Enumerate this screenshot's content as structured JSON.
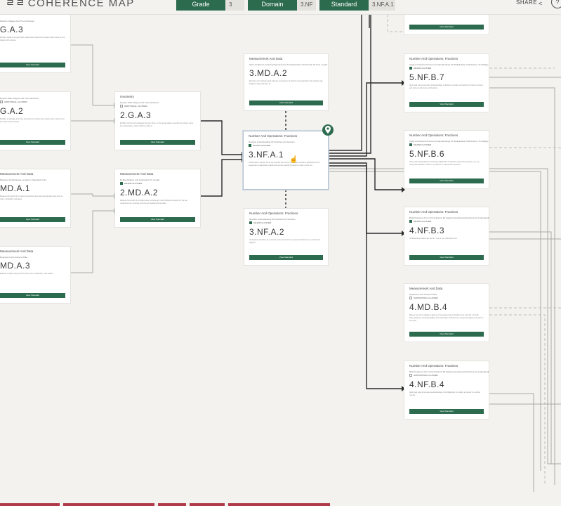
{
  "app": {
    "logo_mark": "ㄹㄹ",
    "title": "COHERENCE MAP"
  },
  "filters": [
    {
      "label": "Grade",
      "value": "3"
    },
    {
      "label": "Domain",
      "value": "3.NF"
    },
    {
      "label": "Standard",
      "value": "3.NF.A.1"
    }
  ],
  "share": {
    "label": "SHARE",
    "icon": "share-icon"
  },
  "help_icon": "?",
  "cards": [
    {
      "id": "l1",
      "domain": "",
      "cluster": "Partition Shapes And Their Attributes",
      "flag": "",
      "flag_type": "major",
      "code": "G.A.3",
      "desc": "Partition shapes into parts with equal areas. Express the area of each part as a unit fraction of the whole.",
      "button": "View Standard"
    },
    {
      "id": "l2",
      "domain": "",
      "cluster": "Reason With Shapes And Their Attributes",
      "flag": "ADDITIONAL CLUSTER",
      "flag_type": "support",
      "code": "G.A.2",
      "desc": "Partition a rectangle into rows and columns of same-size squares and count to find the total number of them.",
      "button": "View Standard"
    },
    {
      "id": "l3",
      "domain": "Measurement And Data",
      "cluster": "Measure And Estimate Lengths In Standard Units",
      "flag": "",
      "flag_type": "major",
      "code": "MD.A.1",
      "desc": "Measure the length of an object by selecting and using appropriate tools such as rulers, yardsticks, and tapes.",
      "button": "View Standard"
    },
    {
      "id": "l4",
      "domain": "Measurement And Data",
      "cluster": "Represent And Interpret Data",
      "flag": "",
      "flag_type": "major",
      "code": "MD.A.3",
      "desc": "Estimate lengths using units of inches, feet, centimeters, and meters.",
      "button": "View Standard"
    },
    {
      "id": "m1",
      "domain": "Geometry",
      "cluster": "Reason With Shapes And Their Attributes",
      "flag": "ADDITIONAL CLUSTER",
      "flag_type": "support",
      "code": "2.G.A.3",
      "desc": "Partition circles and rectangles into two, three, or four equal shares, describe the shares using the words halves, thirds, half of, a third of.",
      "button": "View Standard"
    },
    {
      "id": "m2",
      "domain": "Measurement And Data",
      "cluster": "Relate Addition And Subtraction To Length",
      "flag": "MAJOR CLUSTER",
      "flag_type": "major",
      "code": "2.MD.A.2",
      "desc": "Measure the length of an object twice, using length units of different lengths for the two measurements; describe how the two measurements relate.",
      "button": "View Standard"
    },
    {
      "id": "c1",
      "domain": "Measurement And Data",
      "cluster": "Solve Problems Involving Measurement And Estimation Of Intervals Of Time, Liquid Volumes, And Masses Of Objects",
      "flag": "",
      "flag_type": "major",
      "code": "3.MD.A.2",
      "desc": "Measure and estimate liquid volumes and masses of objects using standard units of grams (g), kilograms (kg), and liters (l).",
      "button": "View Standard"
    },
    {
      "id": "c2",
      "domain": "Number And Operations: Fractions",
      "cluster": "Develop Understanding Of Fractions As Numbers",
      "flag": "MAJOR CLUSTER",
      "flag_type": "major",
      "code": "3.NF.A.1",
      "desc": "Understand a fraction 1/b as the quantity formed by 1 part when a whole is partitioned into b equal parts; understand a fraction a/b as the quantity formed by a parts of size 1/b.",
      "button": ""
    },
    {
      "id": "c3",
      "domain": "Number And Operations: Fractions",
      "cluster": "Develop Understanding Of Fractions As Numbers",
      "flag": "MAJOR CLUSTER",
      "flag_type": "major",
      "code": "3.NF.A.2",
      "desc": "Understand a fraction as a number on the number line; represent fractions on a number line diagram.",
      "button": "View Standard"
    },
    {
      "id": "r1",
      "domain": "Number And Operations: Fractions",
      "cluster": "Apply And Extend Previous Understandings Of Multiplication And Division To Multiply And Divide Fractions",
      "flag": "MAJOR CLUSTER",
      "flag_type": "major",
      "code": "5.NF.B.7",
      "desc": "Apply and extend previous understandings of division to divide unit fractions by whole numbers and whole numbers by unit fractions.",
      "button": "View Standard"
    },
    {
      "id": "r2",
      "domain": "Number And Operations: Fractions",
      "cluster": "Apply And Extend Previous Understandings Of Multiplication And Division To Multiply And Divide Fractions",
      "flag": "MAJOR CLUSTER",
      "flag_type": "major",
      "code": "5.NF.B.6",
      "desc": "Solve real world problems involving multiplication of fractions and mixed numbers, e.g., by using visual fraction models or equations to represent the problem.",
      "button": "View Standard"
    },
    {
      "id": "r3",
      "domain": "Number And Operations: Fractions",
      "cluster": "Build Fractions From Unit Fractions By Applying And Extending Previous Understandings Of Operations On Whole Numbers",
      "flag": "MAJOR CLUSTER",
      "flag_type": "major",
      "code": "4.NF.B.3",
      "desc": "Understand a fraction a/b with a > 1 as a sum of fractions 1/b.",
      "button": "View Standard"
    },
    {
      "id": "r4",
      "domain": "Measurement And Data",
      "cluster": "Represent And Interpret Data",
      "flag": "SUPPORTING CLUSTER",
      "flag_type": "support",
      "code": "4.MD.B.4",
      "desc": "Make a line plot to display a data set of measurements in fractions of a unit (1/2, 1/4, 1/8). Solve problems involving addition and subtraction of fractions by using information presented in line plots.",
      "button": "View Standard"
    },
    {
      "id": "r5",
      "domain": "Number And Operations: Fractions",
      "cluster": "Build Fractions From Unit Fractions By Applying And Extending Previous Understandings Of Operations On Whole Numbers",
      "flag": "SUPPORTING CLUSTER",
      "flag_type": "support",
      "code": "4.NF.B.4",
      "desc": "Apply and extend previous understandings of multiplication to multiply a fraction by a whole number.",
      "button": "View Standard"
    },
    {
      "id": "rtop",
      "domain": "",
      "cluster": "",
      "flag": "",
      "flag_type": "major",
      "code": "",
      "desc": "",
      "button": "View Standard"
    }
  ],
  "focus_pin_icon": "map-pin-icon",
  "cursor_icon": "hand-cursor-icon",
  "colors": {
    "brand_green": "#2d6b4f",
    "background": "#f3f2ef",
    "edge": "#8c8c8c",
    "bottom_bar": "#b13a4a"
  }
}
